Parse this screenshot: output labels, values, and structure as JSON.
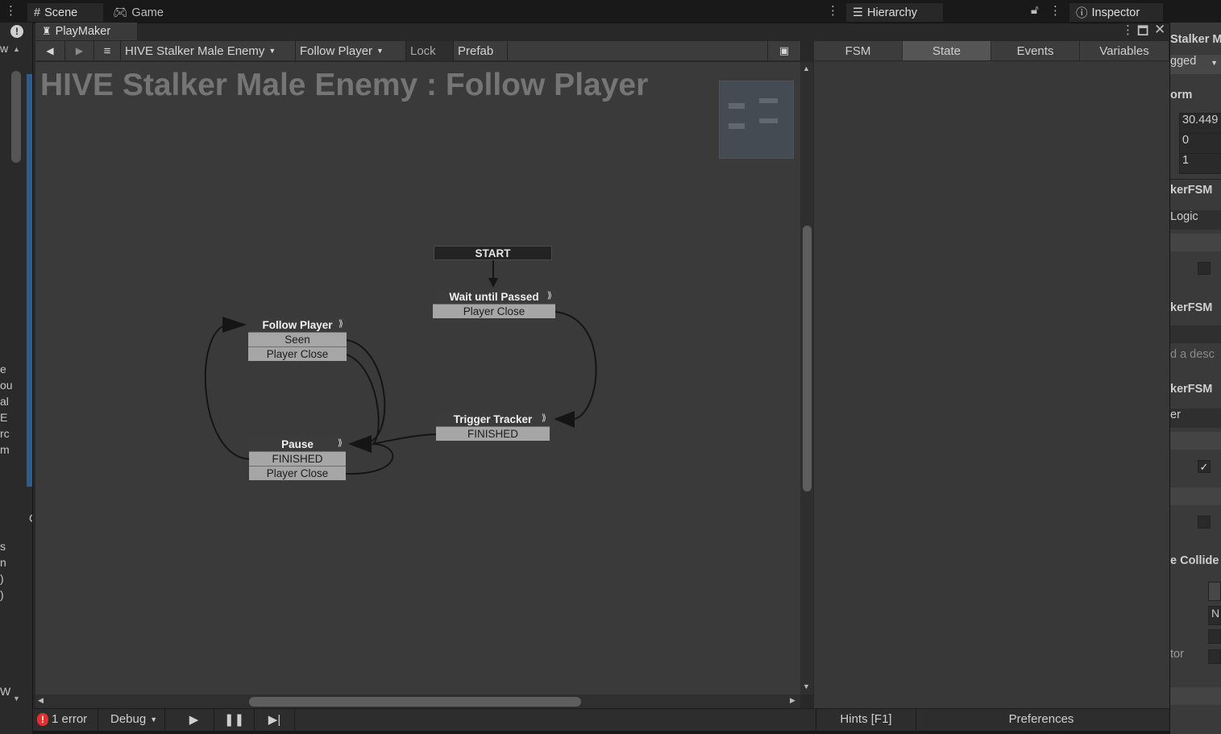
{
  "top_tabs": {
    "scene": "Scene",
    "game": "Game",
    "hierarchy": "Hierarchy",
    "inspector": "Inspector"
  },
  "playmaker": {
    "tab_label": "PlayMaker",
    "toolbar": {
      "fsm_owner": "HIVE Stalker Male Enemy",
      "fsm_name": "Follow Player",
      "lock": "Lock",
      "prefab": "Prefab"
    },
    "right_tabs": [
      "FSM",
      "State",
      "Events",
      "Variables"
    ],
    "selected_right_tab": "State",
    "graph_title": "HIVE Stalker Male Enemy : Follow Player",
    "start_label": "START",
    "states": {
      "wait": {
        "name": "Wait until Passed",
        "transitions": [
          "Player Close"
        ]
      },
      "follow": {
        "name": "Follow Player",
        "transitions": [
          "Seen",
          "Player Close"
        ]
      },
      "trigger": {
        "name": "Trigger Tracker",
        "transitions": [
          "FINISHED"
        ]
      },
      "pause": {
        "name": "Pause",
        "transitions": [
          "FINISHED",
          "Player Close"
        ]
      }
    },
    "bottom": {
      "errors": "1 error",
      "debug": "Debug",
      "hints": "Hints [F1]",
      "preferences": "Preferences"
    }
  },
  "inspector_partial": {
    "name": "Stalker M",
    "tag": "gged",
    "transform": "orm",
    "x": "30.449",
    "y": "0",
    "z": "1",
    "fsm1": "kerFSM",
    "logic": "Logic",
    "fsm2": "kerFSM",
    "desc": "d a desc",
    "fsm3": "kerFSM",
    "field": "er",
    "collider": "e Collide",
    "n_field": "N",
    "tor": "tor"
  },
  "left_fragments": [
    "w",
    "e",
    "ou",
    "al",
    "E",
    "rc",
    "m",
    "s",
    "n",
    ")",
    ")",
    "W",
    "C"
  ],
  "colors": {
    "accent_selected_tab": "#555555",
    "graph_bg": "#3a3a3a",
    "transition_bg": "#a6a6a6",
    "error_red": "#e03030"
  }
}
